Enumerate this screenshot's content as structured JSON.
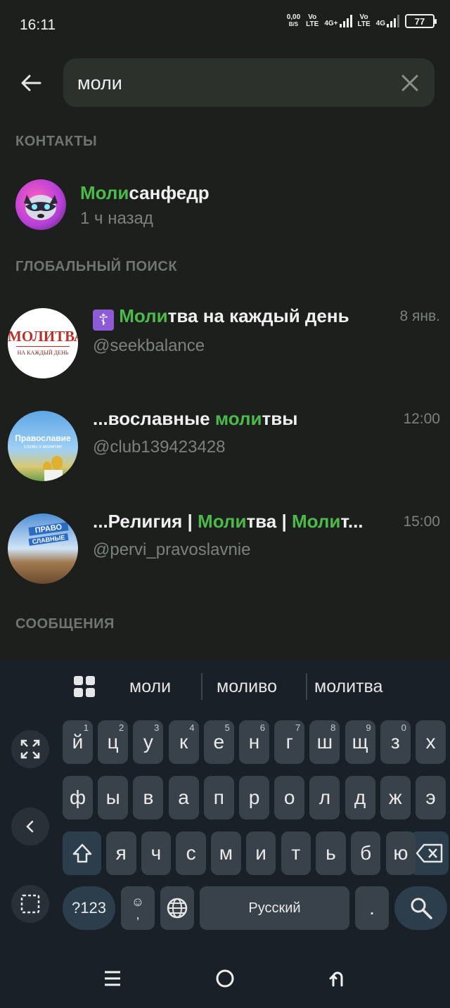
{
  "status": {
    "time": "16:11",
    "speed_value": "0,00",
    "speed_unit": "B/S",
    "sim1": "Vo\nLTE",
    "sim1_net": "4G+",
    "sim2": "Vo\nLTE",
    "sim2_net": "4G",
    "battery": "77"
  },
  "search": {
    "value": "моли",
    "placeholder": ""
  },
  "contacts": {
    "header": "КОНТАКТЫ",
    "items": [
      {
        "title_hl": "Моли",
        "title_rest": "санфедр",
        "subtitle": "1 ч назад"
      }
    ]
  },
  "global": {
    "header": "ГЛОБАЛЬНЫЙ ПОИСК",
    "items": [
      {
        "emoji": "☦️",
        "title_hl": "Моли",
        "title_rest": "тва на каждый день",
        "handle": "@seekbalance",
        "time": "8 янв.",
        "avatar_text_top": "МОЛИТВА",
        "avatar_text_bottom": "НА КАЖДЫЙ ДЕНЬ"
      },
      {
        "title_pre": "...вославные ",
        "title_hl": "моли",
        "title_rest": "твы",
        "handle": "@club139423428",
        "time": "12:00",
        "avatar_text_top": "Православие",
        "avatar_text_bottom": "слово о молитве"
      },
      {
        "title_pre": "...Религия | ",
        "title_hl": "Моли",
        "title_mid": "тва | ",
        "title_hl2": "Моли",
        "title_rest": "т...",
        "handle": "@pervi_pravoslavnie",
        "time": "15:00",
        "avatar_text_top": "ПРАВО",
        "avatar_text_bottom": "СЛАВНЫЕ"
      }
    ]
  },
  "messages": {
    "header": "СООБЩЕНИЯ"
  },
  "keyboard": {
    "suggestions": [
      "моли",
      "моливо",
      "молитва"
    ],
    "row1": [
      {
        "k": "й",
        "n": "1"
      },
      {
        "k": "ц",
        "n": "2"
      },
      {
        "k": "у",
        "n": "3"
      },
      {
        "k": "к",
        "n": "4"
      },
      {
        "k": "е",
        "n": "5"
      },
      {
        "k": "н",
        "n": "6"
      },
      {
        "k": "г",
        "n": "7"
      },
      {
        "k": "ш",
        "n": "8"
      },
      {
        "k": "щ",
        "n": "9"
      },
      {
        "k": "з",
        "n": "0"
      },
      {
        "k": "х",
        "n": ""
      }
    ],
    "row2": [
      "ф",
      "ы",
      "в",
      "а",
      "п",
      "р",
      "о",
      "л",
      "д",
      "ж",
      "э"
    ],
    "row3": [
      "я",
      "ч",
      "с",
      "м",
      "и",
      "т",
      "ь",
      "б",
      "ю"
    ],
    "symbols_label": "?123",
    "space_label": "Русский",
    "period_label": ".",
    "comma_label": ","
  },
  "colors": {
    "background": "#1c1f1c",
    "accent": "#4cb94a",
    "keyboard_bg": "#1a2028",
    "key_bg": "#39414b"
  }
}
